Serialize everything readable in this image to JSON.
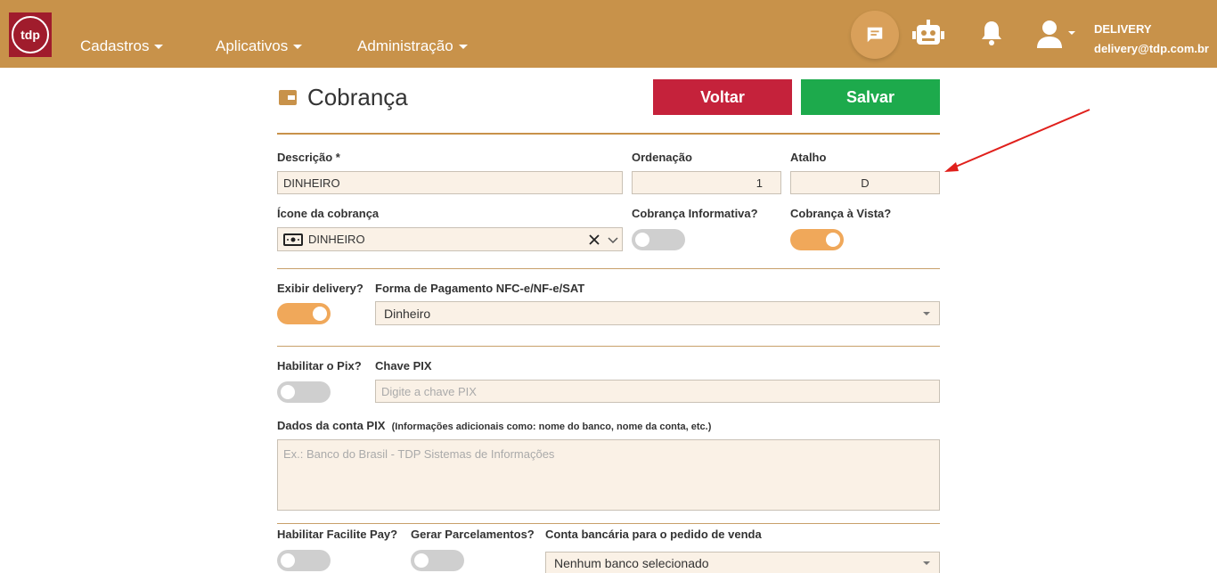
{
  "header": {
    "logo_text": "tdp",
    "nav": [
      {
        "label": "Cadastros"
      },
      {
        "label": "Aplicativos"
      },
      {
        "label": "Administração"
      }
    ],
    "user": {
      "name": "DELIVERY",
      "email": "delivery@tdp.com.br"
    }
  },
  "page": {
    "title": "Cobrança",
    "back_label": "Voltar",
    "save_label": "Salvar"
  },
  "form": {
    "descricao": {
      "label": "Descrição *",
      "value": "DINHEIRO"
    },
    "ordenacao": {
      "label": "Ordenação",
      "value": "1"
    },
    "atalho": {
      "label": "Atalho",
      "value": "D"
    },
    "icone": {
      "label": "Ícone da cobrança",
      "value": "DINHEIRO"
    },
    "informativa": {
      "label": "Cobrança Informativa?",
      "on": false
    },
    "a_vista": {
      "label": "Cobrança à Vista?",
      "on": true
    },
    "exibir_delivery": {
      "label": "Exibir delivery?",
      "on": true
    },
    "forma_pagamento": {
      "label": "Forma de Pagamento NFC-e/NF-e/SAT",
      "value": "Dinheiro"
    },
    "habilitar_pix": {
      "label": "Habilitar o Pix?",
      "on": false
    },
    "chave_pix": {
      "label": "Chave PIX",
      "placeholder": "Digite a chave PIX"
    },
    "dados_pix": {
      "label": "Dados da conta PIX",
      "hint": "(Informações adicionais como: nome do banco, nome da conta, etc.)",
      "placeholder": "Ex.: Banco do Brasil - TDP Sistemas de Informações"
    },
    "facilite_pay": {
      "label": "Habilitar Facilite Pay?",
      "on": false
    },
    "parcelamentos": {
      "label": "Gerar Parcelamentos?",
      "on": false
    },
    "conta_bancaria": {
      "label": "Conta bancária para o pedido de venda",
      "value": "Nenhum banco selecionado"
    }
  },
  "colors": {
    "header": "#c8924a",
    "back": "#c5223b",
    "save": "#1daa4c",
    "toggle_on": "#f0a85a",
    "annotation_arrow": "#e0201c"
  }
}
